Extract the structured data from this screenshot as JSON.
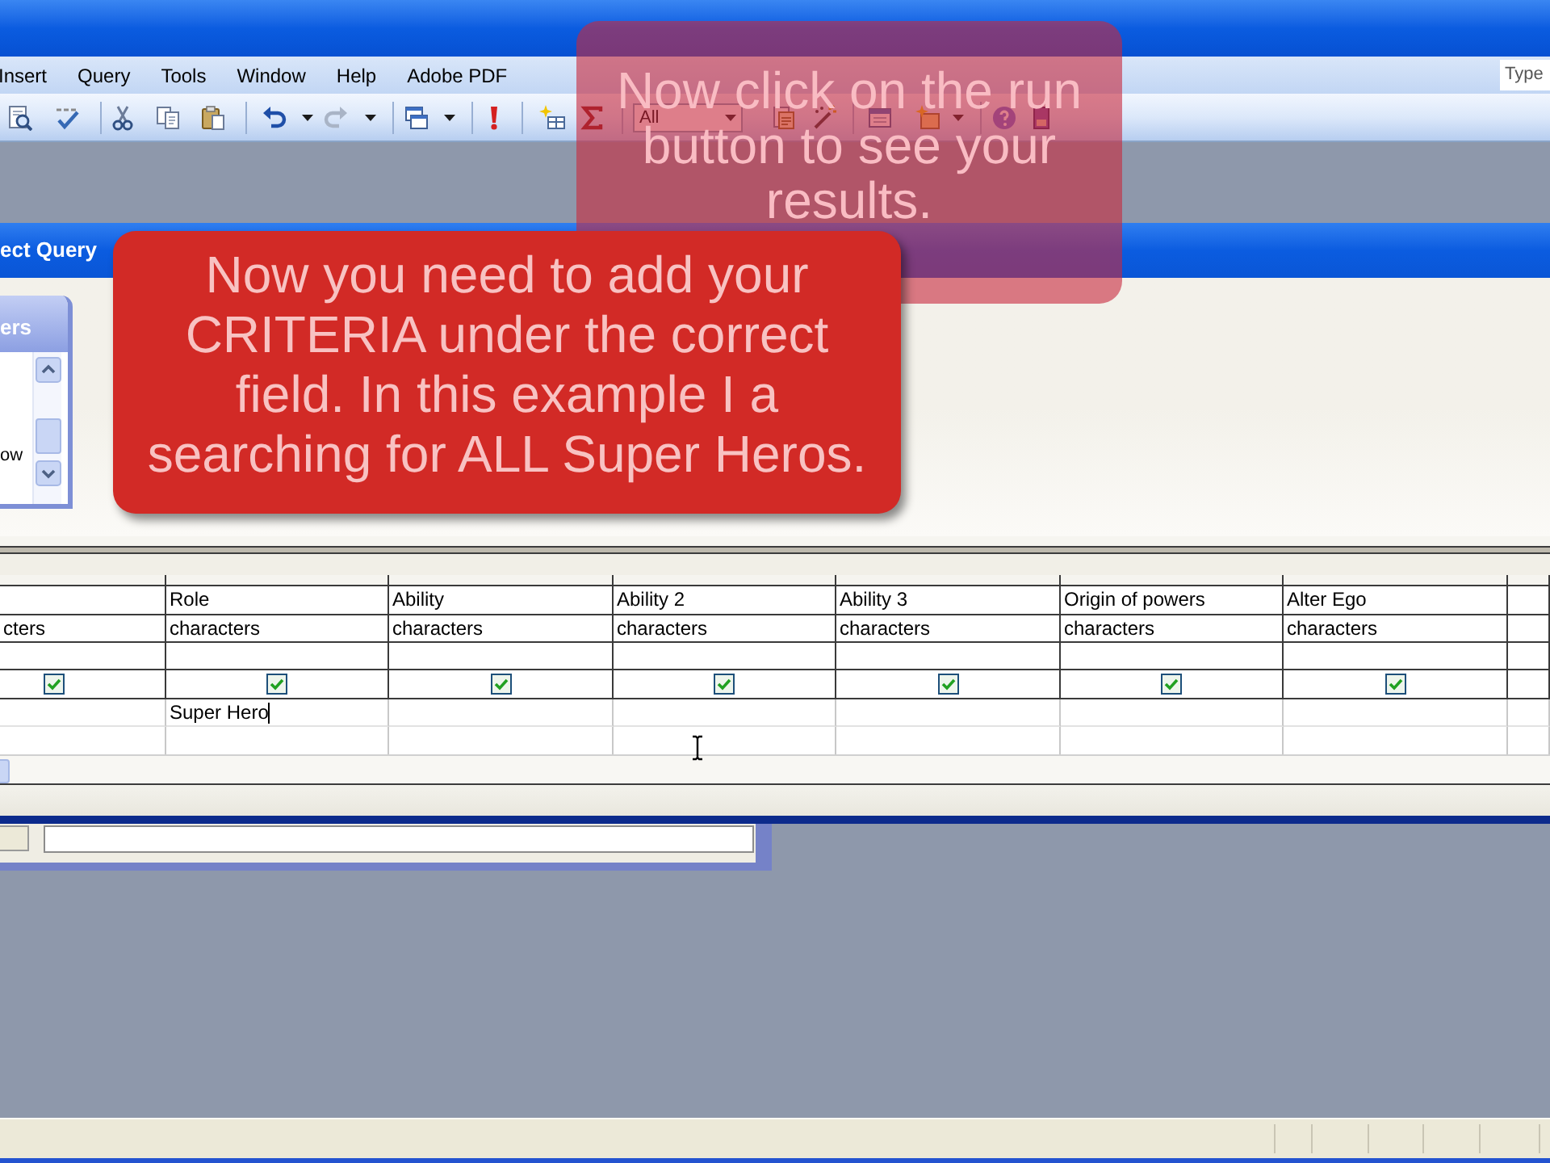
{
  "menu_bar": {
    "items": [
      "Insert",
      "Query",
      "Tools",
      "Window",
      "Help",
      "Adobe PDF"
    ],
    "help_box": {
      "placeholder": "Type"
    }
  },
  "toolbar": {
    "top_values": "All"
  },
  "query_window": {
    "title": "ect Query",
    "table_list": {
      "title": "ers",
      "items": [
        "ow"
      ]
    }
  },
  "grid": {
    "columns": [
      {
        "table": "cters",
        "show": true
      },
      {
        "field": "Role",
        "table": "characters",
        "show": true,
        "criteria": "Super Hero",
        "focused": true
      },
      {
        "field": "Ability",
        "table": "characters",
        "show": true
      },
      {
        "field": "Ability 2",
        "table": "characters",
        "show": true
      },
      {
        "field": "Ability 3",
        "table": "characters",
        "show": true
      },
      {
        "field": "Origin of powers",
        "table": "characters",
        "show": true
      },
      {
        "field": "Alter Ego",
        "table": "characters",
        "show": true
      }
    ]
  },
  "callouts": [
    {
      "kind": "translucent",
      "text": "Now click on the run button to see your results."
    },
    {
      "kind": "solid",
      "text": "Now you need to add your CRITERIA under the correct field. In this example I a searching for ALL Super Heros."
    }
  ]
}
